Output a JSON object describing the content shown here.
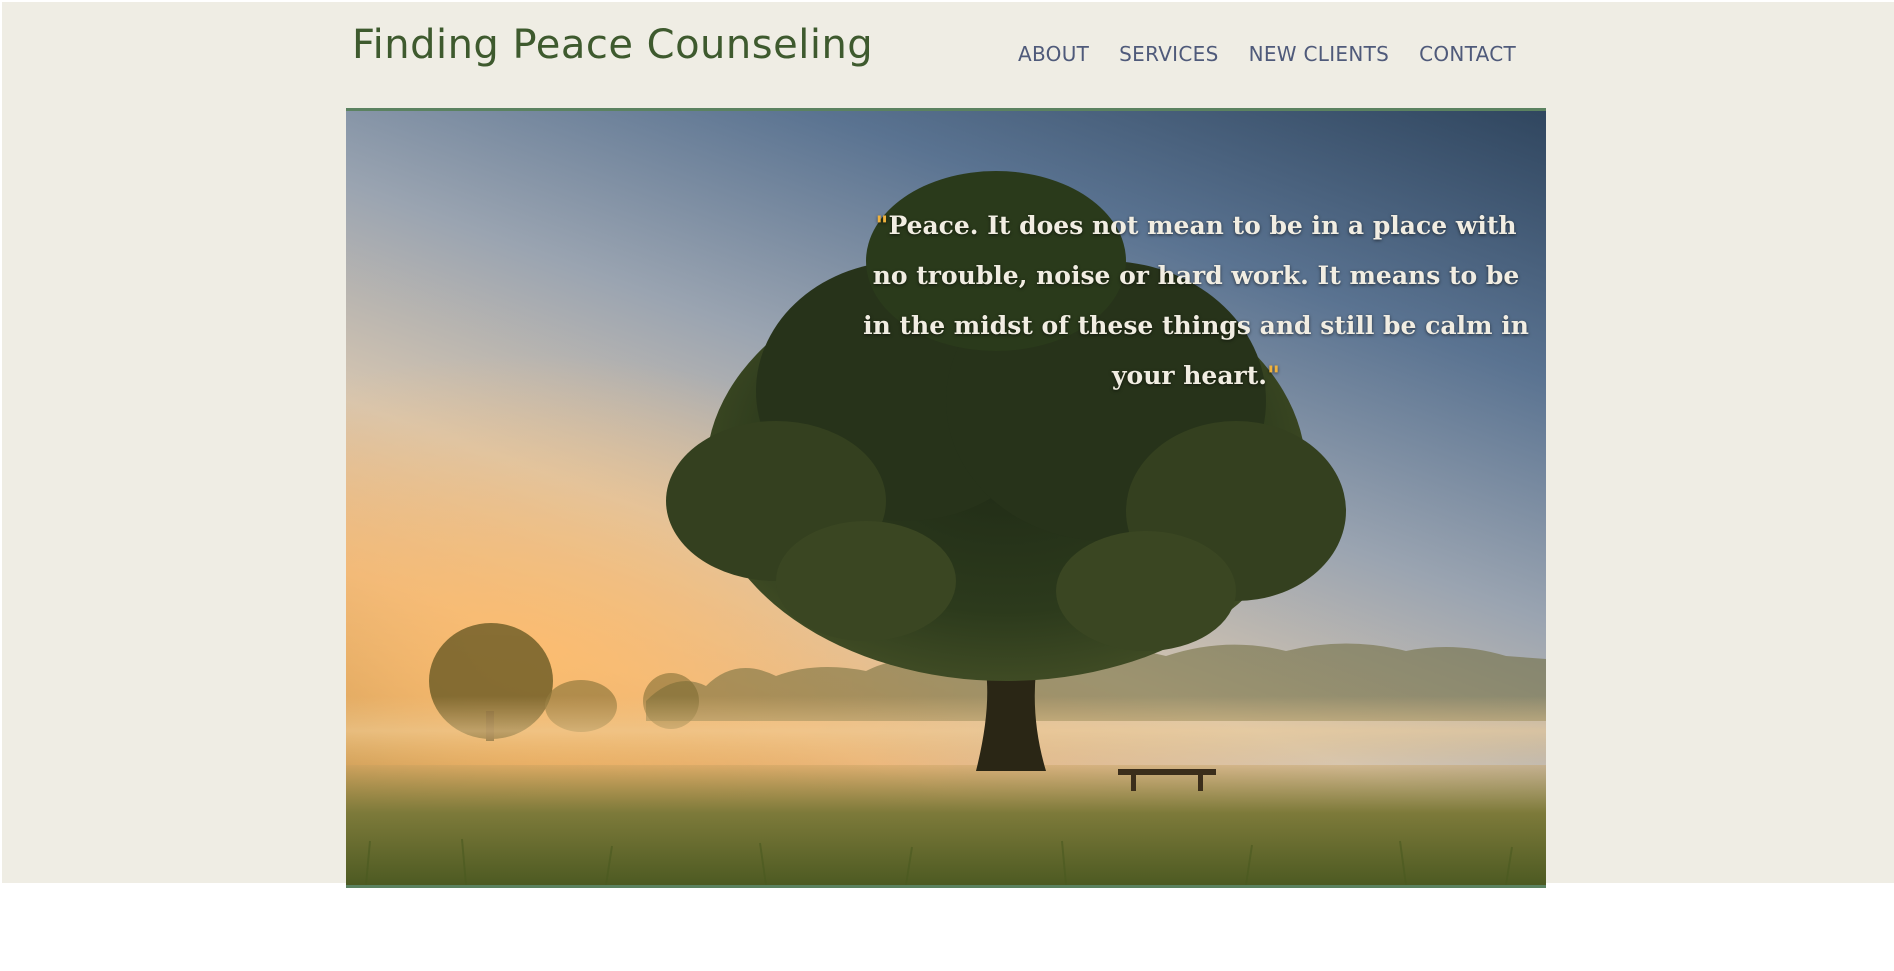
{
  "site": {
    "title": "Finding Peace Counseling"
  },
  "nav": {
    "items": [
      "ABOUT",
      "SERVICES",
      "NEW CLIENTS",
      "CONTACT"
    ]
  },
  "hero": {
    "quote_open": "\"",
    "quote_text": "Peace. It does not mean to be in a place with no trouble, noise or hard work. It means to be in the midst of these things and still be calm in your heart.",
    "quote_close": "\"",
    "image": "tree-in-misty-field-at-sunrise"
  },
  "colors": {
    "background": "#efede4",
    "title": "#3e5a2e",
    "nav": "#4f5a7a",
    "hero_border": "#5b8260",
    "quote_mark": "#f0b23d"
  }
}
